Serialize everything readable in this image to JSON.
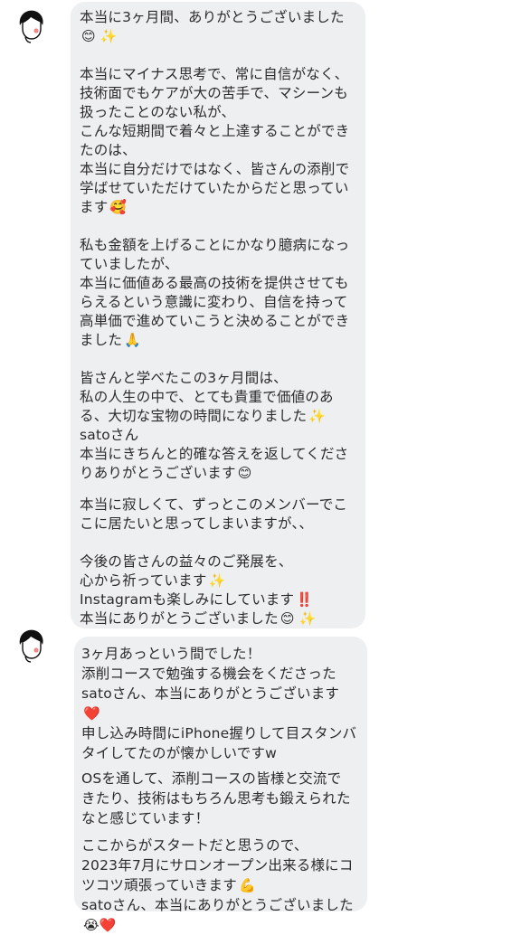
{
  "colors": {
    "bubble": "#eeeff1",
    "text": "#2b2b2b",
    "background": "#ffffff",
    "heart": "#e01a2a",
    "sparkle": "#f3c54a",
    "smile": "#b04ad6"
  },
  "messages": [
    {
      "avatar_icon": "girl-avatar-icon",
      "lines": [
        {
          "text": "本当に3ヶ月間、ありがとうございました",
          "emoji": ""
        },
        {
          "text": "",
          "emoji": "😊 ✨"
        },
        {
          "text": "",
          "emoji": ""
        },
        {
          "text": "本当にマイナス思考で、常に自信がなく、",
          "emoji": ""
        },
        {
          "text": "技術面でもケアが大の苦手で、マシーンも",
          "emoji": ""
        },
        {
          "text": "扱ったことのない私が、",
          "emoji": ""
        },
        {
          "text": "こんな短期間で着々と上達することができ",
          "emoji": ""
        },
        {
          "text": "たのは、",
          "emoji": ""
        },
        {
          "text": "本当に自分だけではなく、皆さんの添削で",
          "emoji": ""
        },
        {
          "text": "学ばせていただけていたからだと思ってい",
          "emoji": ""
        },
        {
          "text": "ます",
          "emoji": "🥰"
        },
        {
          "text": "",
          "emoji": ""
        },
        {
          "text": "私も金額を上げることにかなり臆病になっ",
          "emoji": ""
        },
        {
          "text": "ていましたが、",
          "emoji": ""
        },
        {
          "text": "本当に価値ある最高の技術を提供させても",
          "emoji": ""
        },
        {
          "text": "らえるという意識に変わり、自信を持って",
          "emoji": ""
        },
        {
          "text": "高単価で進めていこうと決めることができ",
          "emoji": ""
        },
        {
          "text": "ました",
          "emoji": "🙏"
        },
        {
          "text": "",
          "emoji": ""
        },
        {
          "text": "皆さんと学べたこの3ヶ月間は、",
          "emoji": ""
        },
        {
          "text": "私の人生の中で、とても貴重で価値のあ",
          "emoji": ""
        },
        {
          "text": "る、大切な宝物の時間になりました",
          "emoji": "✨"
        },
        {
          "text": "satoさん",
          "emoji": ""
        },
        {
          "text": "本当にきちんと的確な答えを返してくださ",
          "emoji": ""
        },
        {
          "text": "りありがとうございます",
          "emoji": "😊"
        },
        {
          "text": "本当に寂しくて、ずっとこのメンバーでこ",
          "emoji": ""
        },
        {
          "text": "こに居たいと思ってしまいますが、、",
          "emoji": ""
        },
        {
          "text": "",
          "emoji": ""
        },
        {
          "text": "今後の皆さんの益々のご発展を、",
          "emoji": ""
        },
        {
          "text": "心から祈っています",
          "emoji": "✨"
        },
        {
          "text": "Instagramも楽しみにしています",
          "emoji": "‼️"
        },
        {
          "text": "本当にありがとうございました",
          "emoji": "😊 ✨"
        }
      ]
    },
    {
      "avatar_icon": "girl-avatar-icon",
      "lines": [
        {
          "text": "3ヶ月あっという間でした！",
          "emoji": ""
        },
        {
          "text": "添削コースで勉強する機会をくださった",
          "emoji": ""
        },
        {
          "text": "satoさん、本当にありがとうございます",
          "emoji": ""
        },
        {
          "text": "",
          "emoji": "❤️"
        },
        {
          "text": "申し込み時間にiPhone握りして目スタンバ",
          "emoji": ""
        },
        {
          "text": "タイしてたのが懐かしいですw",
          "emoji": ""
        },
        {
          "text": "OSを通して、添削コースの皆様と交流で",
          "emoji": ""
        },
        {
          "text": "きたり、技術はもちろん思考も鍛えられた",
          "emoji": ""
        },
        {
          "text": "なと感じています！",
          "emoji": ""
        },
        {
          "text": "ここからがスタートだと思うので、",
          "emoji": ""
        },
        {
          "text": "2023年7月にサロンオープン出来る様にコ",
          "emoji": ""
        },
        {
          "text": "ツコツ頑張っていきます",
          "emoji": "💪"
        },
        {
          "text": "satoさん、本当にありがとうございました",
          "emoji": ""
        },
        {
          "text": "",
          "emoji": "😭❤️"
        }
      ]
    }
  ]
}
